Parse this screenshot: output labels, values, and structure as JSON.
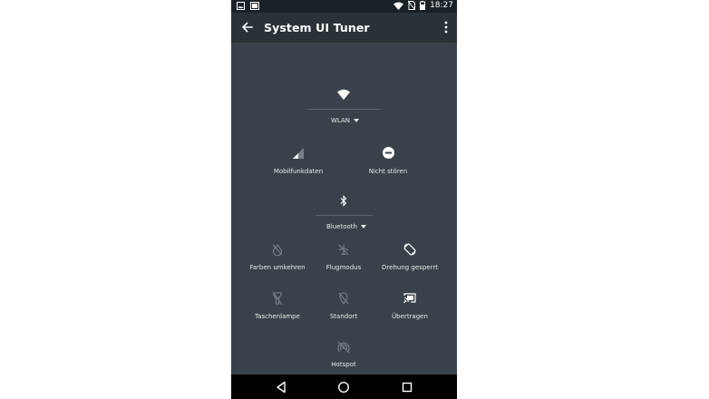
{
  "status_bar": {
    "time": "18:27",
    "icons": [
      "image-notification-icon",
      "screenshot-notification-icon",
      "wifi-icon",
      "no-sim-icon",
      "battery-icon"
    ]
  },
  "app_bar": {
    "title": "System UI Tuner"
  },
  "tiles": {
    "wlan": {
      "label": "WLAN",
      "icon": "wifi-icon"
    },
    "mobile_data": {
      "label": "Mobilfunkdaten",
      "icon": "signal-icon"
    },
    "do_not_disturb": {
      "label": "Nicht stören",
      "icon": "do-not-disturb-icon"
    },
    "bluetooth": {
      "label": "Bluetooth",
      "icon": "bluetooth-icon"
    },
    "invert_colors": {
      "label": "Farben umkehren",
      "icon": "invert-colors-icon"
    },
    "airplane_mode": {
      "label": "Flugmodus",
      "icon": "airplane-icon"
    },
    "rotation_lock": {
      "label": "Drehung gesperrt",
      "icon": "rotation-lock-icon"
    },
    "flashlight": {
      "label": "Taschenlampe",
      "icon": "flashlight-icon"
    },
    "location": {
      "label": "Standort",
      "icon": "location-off-icon"
    },
    "cast": {
      "label": "Übertragen",
      "icon": "cast-icon"
    },
    "hotspot": {
      "label": "Hotspot",
      "icon": "hotspot-icon"
    }
  },
  "colors": {
    "panel_bg": "#39424a",
    "app_bar_bg": "#2b3237",
    "status_bar_bg": "#1b2227",
    "nav_bar_bg": "#000000",
    "icon_active": "#ffffff",
    "icon_inactive": "#76818a"
  },
  "nav_bar": {
    "buttons": [
      "back-triangle-icon",
      "home-circle-icon",
      "recents-square-icon"
    ]
  }
}
